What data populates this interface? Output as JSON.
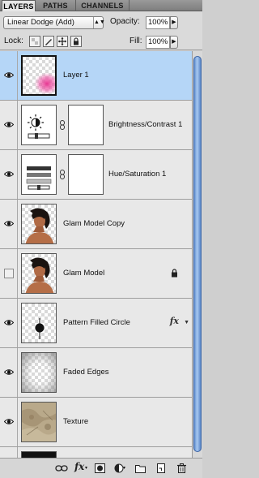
{
  "tabs": [
    {
      "label": "LAYERS",
      "active": true
    },
    {
      "label": "PATHS",
      "active": false
    },
    {
      "label": "CHANNELS",
      "active": false
    }
  ],
  "options": {
    "blend_mode": "Linear Dodge (Add)",
    "opacity_label": "Opacity:",
    "opacity_value": "100%",
    "lock_label": "Lock:",
    "fill_label": "Fill:",
    "fill_value": "100%"
  },
  "layers": [
    {
      "name": "Layer 1",
      "visible": true,
      "selected": true,
      "thumb": "pink-brush-on-transparent"
    },
    {
      "name": "Brightness/Contrast 1",
      "visible": true,
      "adjustment": true,
      "thumb": "brightness-contrast-icon"
    },
    {
      "name": "Hue/Saturation 1",
      "visible": true,
      "adjustment": true,
      "thumb": "hue-saturation-icon"
    },
    {
      "name": "Glam Model Copy",
      "visible": true,
      "thumb": "model-portrait"
    },
    {
      "name": "Glam Model",
      "visible": false,
      "locked": true,
      "thumb": "model-portrait"
    },
    {
      "name": "Pattern Filled Circle",
      "visible": true,
      "has_effects": true,
      "fx_label": "fx",
      "thumb": "circle-on-transparent"
    },
    {
      "name": "Faded Edges",
      "visible": true,
      "thumb": "gray-gradient-edges"
    },
    {
      "name": "Texture",
      "visible": true,
      "thumb": "stone-texture"
    }
  ],
  "bottom_toolbar": {
    "icons": [
      "link-layers-icon",
      "add-style-icon",
      "add-mask-icon",
      "new-adjustment-icon",
      "new-group-icon",
      "new-layer-icon",
      "trash-icon"
    ],
    "fx_label": "fx"
  },
  "colors": {
    "selection": "#b5d6f7",
    "scrollbar": "#6a98d8",
    "brush_pink": "#e8308f"
  }
}
